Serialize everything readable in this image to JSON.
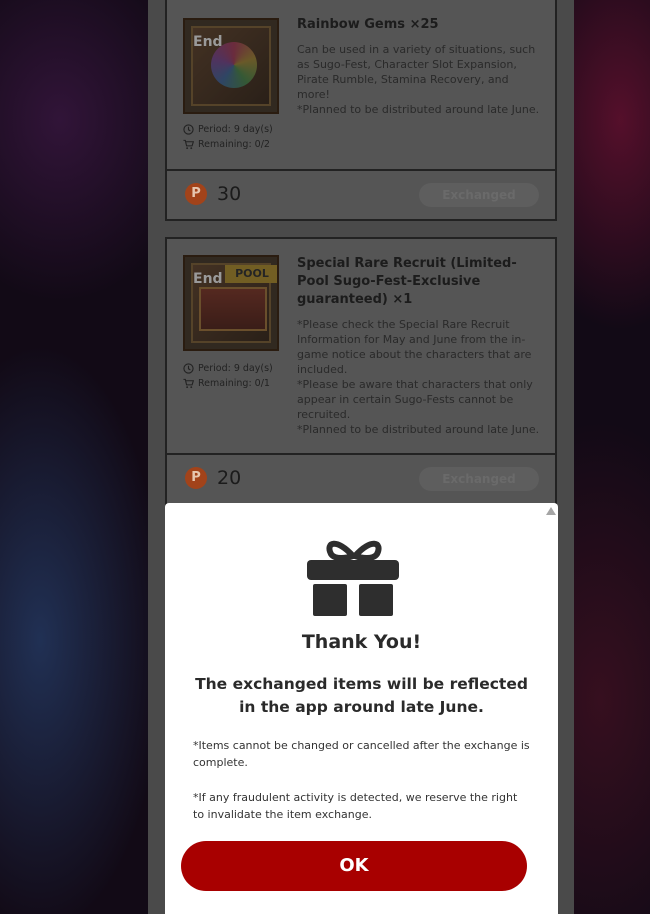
{
  "items": [
    {
      "thumbnail_badge": "End",
      "title": "Rainbow Gems ×25",
      "description": "Can be used in a variety of situations, such as Sugo-Fest, Character Slot Expansion, Pirate Rumble, Stamina Recovery, and more!\n*Planned to be distributed around late June.",
      "period": "Period:  9 day(s)",
      "remaining": "Remaining:  0/2",
      "point_icon": "P",
      "points": "30",
      "button_label": "Exchanged"
    },
    {
      "thumbnail_badge": "End",
      "thumbnail_tag": "POOL",
      "title": "Special Rare Recruit (Limited-Pool Sugo-Fest-Exclusive guaranteed) ×1",
      "description": "*Please check the Special Rare Recruit Information for May and June from the in-game notice about the characters that are included.\n*Please be aware that characters that only appear in certain Sugo-Fests cannot be recruited.\n*Planned to be distributed around late June.",
      "period": "Period:  9 day(s)",
      "remaining": "Remaining:  0/1",
      "point_icon": "P",
      "points": "20",
      "button_label": "Exchanged"
    }
  ],
  "modal": {
    "icon": "gift-icon",
    "title": "Thank You!",
    "message": "The exchanged items will be reflected in the app around late June.",
    "note1": "*Items cannot be changed or cancelled after the exchange is complete.",
    "note2": "*If any fraudulent activity is detected, we reserve the right to invalidate the item exchange.",
    "ok_label": "OK"
  },
  "colors": {
    "ok_button": "#a80000",
    "point_icon": "#a2431a",
    "overlay_card": "#555555"
  }
}
